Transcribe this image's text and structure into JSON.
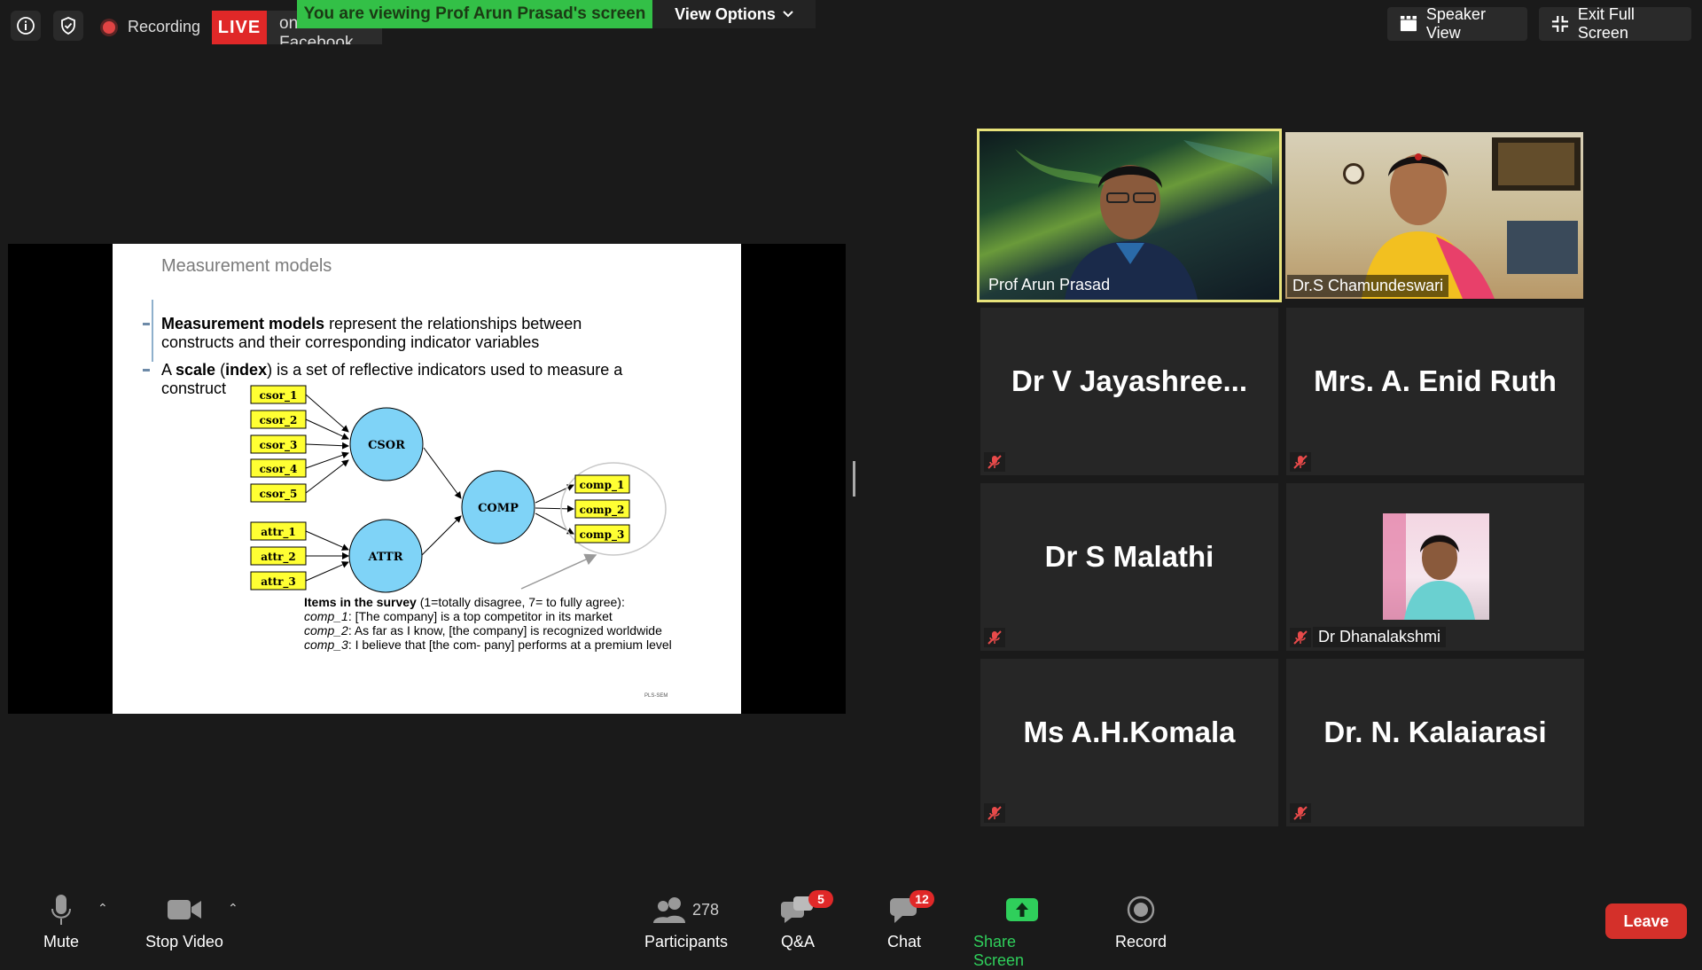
{
  "topbar": {
    "recording_label": "Recording",
    "live_label": "LIVE",
    "live_destination": "on Facebook",
    "viewing_banner": "You are viewing Prof Arun Prasad's screen",
    "view_options": "View Options",
    "speaker_view": "Speaker View",
    "exit_full_screen": "Exit Full Screen"
  },
  "slide": {
    "title": "Measurement models",
    "bullet1_bold": "Measurement models",
    "bullet1_rest": " represent the relationships between",
    "bullet1_line2": "constructs and their corresponding indicator variables",
    "bullet2_a": "A ",
    "bullet2_bold1": "scale",
    "bullet2_b": " (",
    "bullet2_bold2": "index",
    "bullet2_c": ") is a set of reflective indicators used to measure a",
    "bullet2_line2": "construct",
    "diagram": {
      "csor_items": [
        "csor_1",
        "csor_2",
        "csor_3",
        "csor_4",
        "csor_5"
      ],
      "attr_items": [
        "attr_1",
        "attr_2",
        "attr_3"
      ],
      "comp_items": [
        "comp_1",
        "comp_2",
        "comp_3"
      ],
      "nodes": [
        "CSOR",
        "ATTR",
        "COMP"
      ]
    },
    "survey_heading": "Items in the survey",
    "survey_heading_rest": " (1=totally disagree, 7= to fully agree):",
    "survey_items": [
      {
        "key": "comp_1",
        "text": ": [The company] is a top competitor in its market"
      },
      {
        "key": "comp_2",
        "text": ": As far as I know, [the company] is recognized worldwide"
      },
      {
        "key": "comp_3",
        "text": ": I believe that [the com- pany] performs at a premium level"
      }
    ],
    "footer": "PLS-SEM"
  },
  "gallery": {
    "active_speaker": "Prof Arun Prasad",
    "video2": "Dr.S Chamundeswari",
    "tiles": [
      {
        "name": "Dr  V  Jayashree..."
      },
      {
        "name": "Mrs. A. Enid Ruth"
      },
      {
        "name": "Dr S Malathi"
      },
      {
        "name": "Dr Dhanalakshmi"
      },
      {
        "name": "Ms A.H.Komala"
      },
      {
        "name": "Dr. N. Kalaiarasi"
      }
    ]
  },
  "toolbar": {
    "mute": "Mute",
    "stop_video": "Stop Video",
    "participants": "Participants",
    "participants_count": "278",
    "qa": "Q&A",
    "qa_badge": "5",
    "chat": "Chat",
    "chat_badge": "12",
    "share_screen": "Share Screen",
    "record": "Record",
    "leave": "Leave"
  },
  "colors": {
    "live": "#e02828",
    "banner": "#33c047",
    "share_green": "#2fcf5b",
    "active_border": "#e7e27a",
    "node_fill": "#7fd3f7",
    "indicator_fill": "#ffff33"
  }
}
